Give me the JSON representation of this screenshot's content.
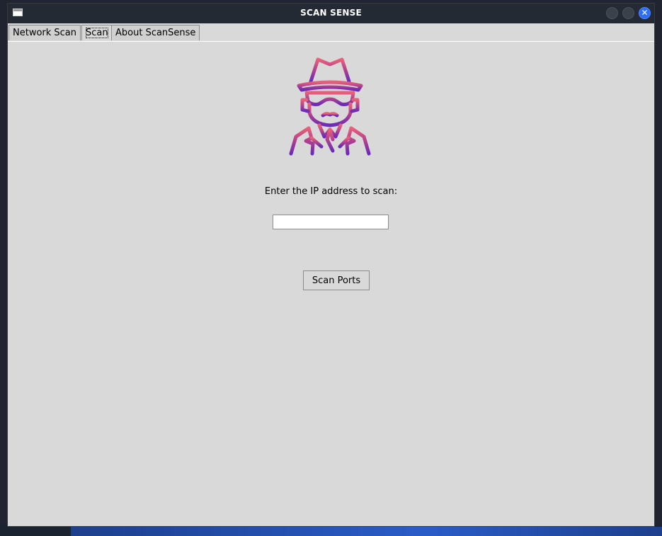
{
  "window": {
    "title": "SCAN SENSE",
    "close_glyph": "✕"
  },
  "tabs": [
    {
      "label": "Network Scan",
      "active": false
    },
    {
      "label": "Scan",
      "active": true
    },
    {
      "label": "About ScanSense",
      "active": false
    }
  ],
  "scan_tab": {
    "logo_icon": "spy-agent-icon",
    "prompt": "Enter the IP address to scan:",
    "ip_input": {
      "value": "",
      "placeholder": ""
    },
    "scan_button_label": "Scan Ports"
  },
  "colors": {
    "titlebar": "#242a33",
    "panel": "#d9d9d9",
    "close_button": "#2f6ef7",
    "icon_gradient_top": "#e8607a",
    "icon_gradient_bottom": "#6b2bb8"
  }
}
